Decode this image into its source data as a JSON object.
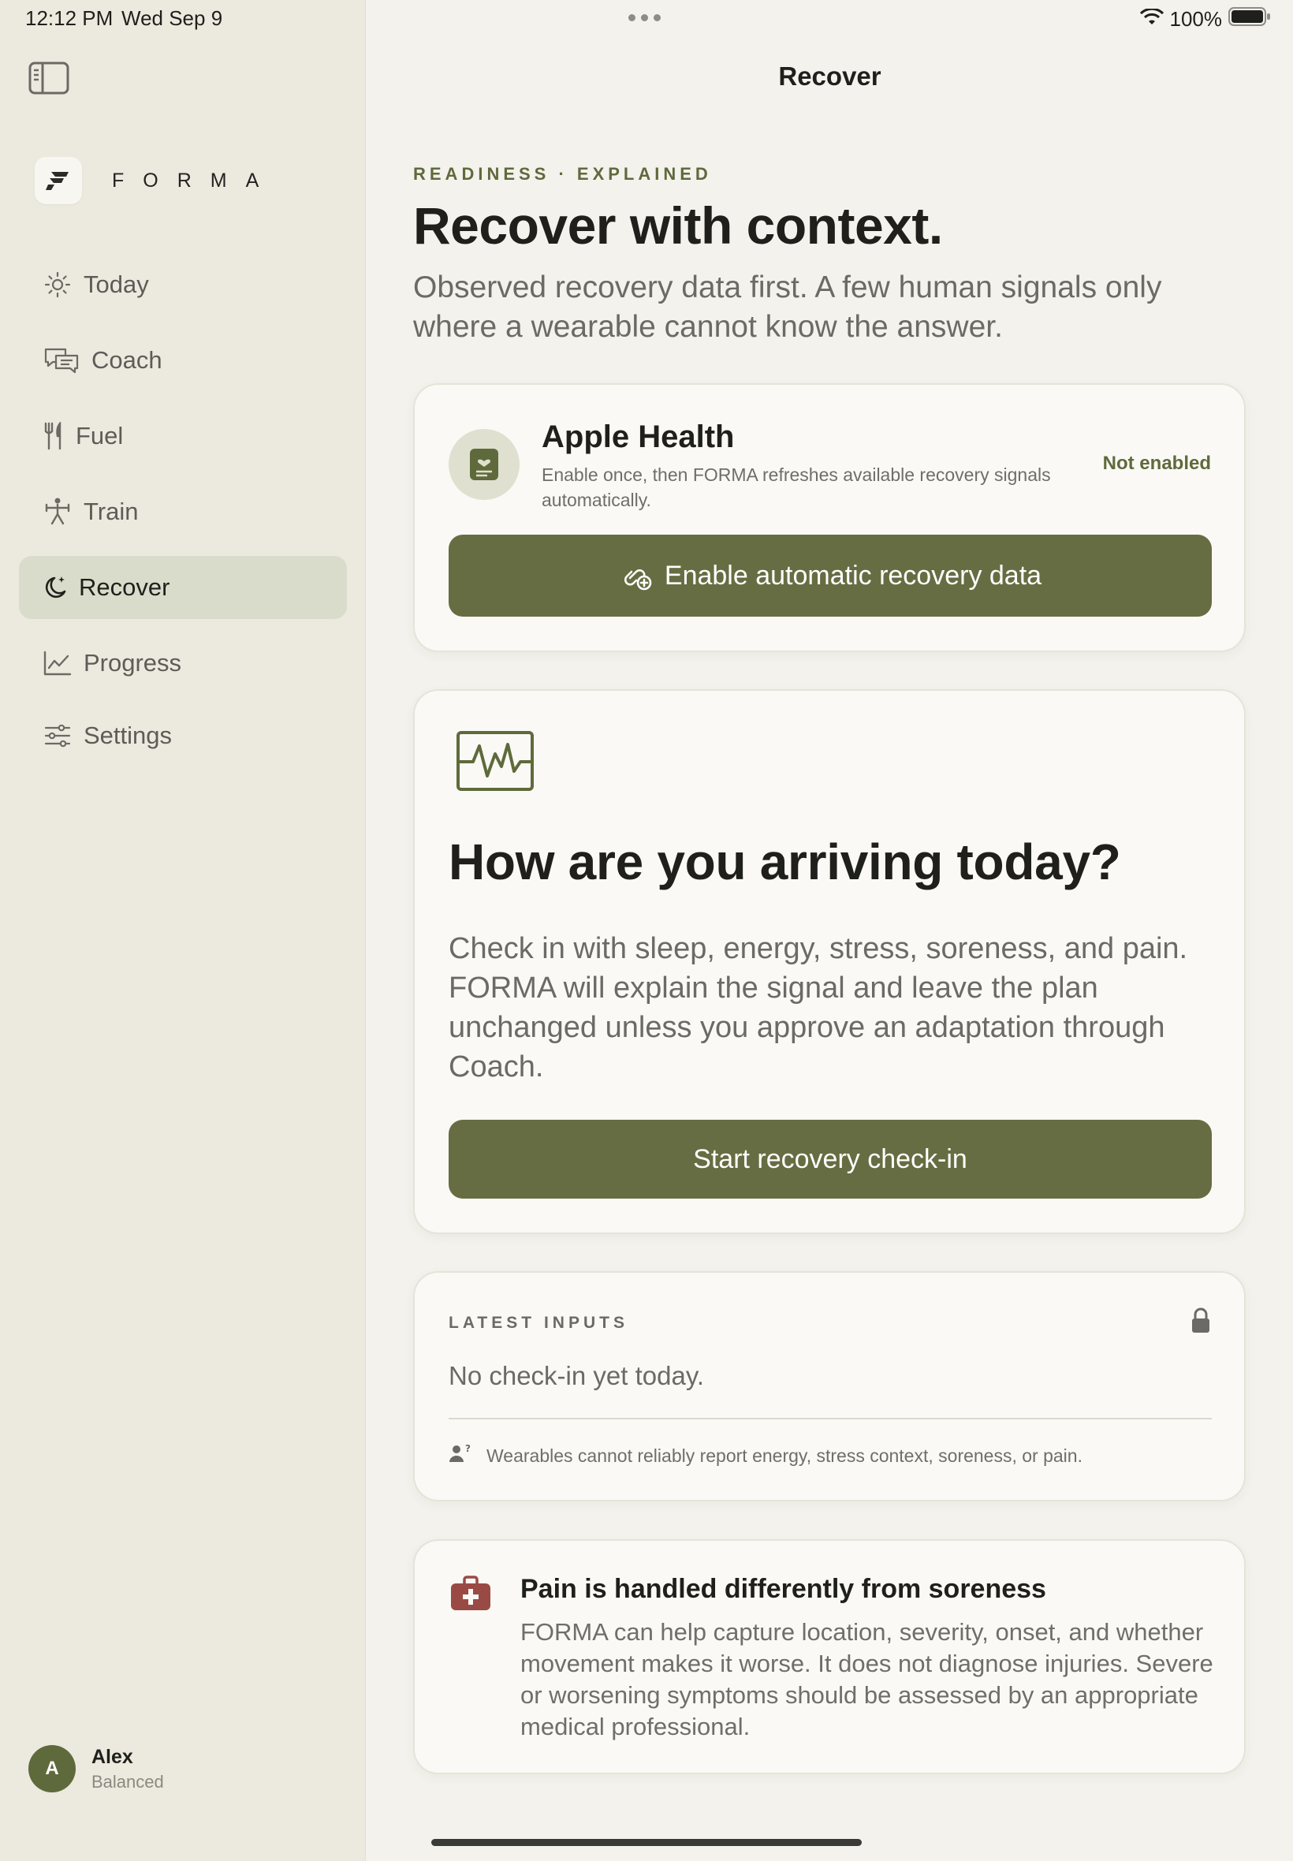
{
  "status_bar": {
    "time": "12:12 PM",
    "date": "Wed Sep 9",
    "battery": "100%"
  },
  "sidebar": {
    "logo_text": "FORMA",
    "items": [
      {
        "label": "Today",
        "icon": "sun-icon"
      },
      {
        "label": "Coach",
        "icon": "chat-icon"
      },
      {
        "label": "Fuel",
        "icon": "fork-knife-icon"
      },
      {
        "label": "Train",
        "icon": "figure-icon"
      },
      {
        "label": "Recover",
        "icon": "moon-icon",
        "active": true
      },
      {
        "label": "Progress",
        "icon": "chart-line-icon"
      },
      {
        "label": "Settings",
        "icon": "sliders-icon"
      }
    ],
    "user": {
      "initial": "A",
      "name": "Alex",
      "status": "Balanced"
    }
  },
  "main": {
    "nav_title": "Recover",
    "eyebrow": "READINESS · EXPLAINED",
    "headline": "Recover with context.",
    "lede": "Observed recovery data first. A few human signals only where a wearable cannot know the answer.",
    "health_card": {
      "title": "Apple Health",
      "description": "Enable once, then FORMA refreshes available recovery signals automatically.",
      "status": "Not enabled",
      "button_label": "Enable automatic recovery data"
    },
    "checkin_card": {
      "title": "How are you arriving today?",
      "body": "Check in with sleep, energy, stress, soreness, and pain. FORMA will explain the signal and leave the plan unchanged unless you approve an adaptation through Coach.",
      "button_label": "Start recovery check-in"
    },
    "latest_inputs": {
      "label": "LATEST INPUTS",
      "empty_text": "No check-in yet today.",
      "note": "Wearables cannot reliably report energy, stress context, soreness, or pain."
    },
    "pain_card": {
      "title": "Pain is handled differently from soreness",
      "body": "FORMA can help capture location, severity, onset, and whether movement makes it worse. It does not diagnose injuries. Severe or worsening symptoms should be assessed by an appropriate medical professional."
    }
  },
  "colors": {
    "accent": "#676d42",
    "sidebar_bg": "#ece9df",
    "active_nav_bg": "#dadccb",
    "page_bg": "#f4f2ec",
    "pain_icon": "#9a4a44"
  }
}
